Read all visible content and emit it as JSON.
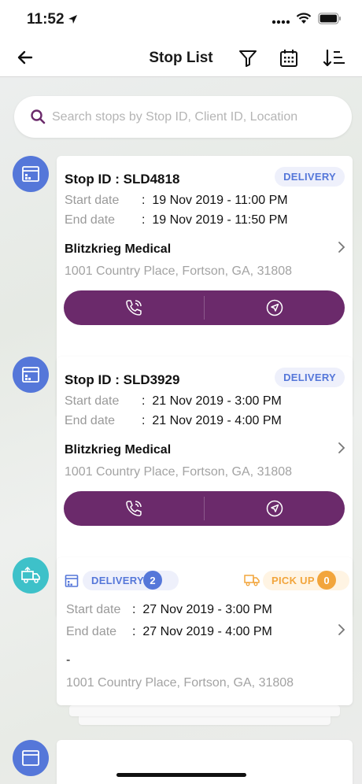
{
  "status_bar": {
    "time": "11:52"
  },
  "nav": {
    "title": "Stop List"
  },
  "search": {
    "placeholder": "Search stops by Stop ID, Client ID, Location"
  },
  "stops": [
    {
      "stop_id": "Stop ID : SLD4818",
      "type_badge": "DELIVERY",
      "start_label": "Start date",
      "start_value": "19 Nov 2019 - 11:00 PM",
      "end_label": "End date",
      "end_value": "19 Nov 2019 - 11:50 PM",
      "client": "Blitzkrieg Medical",
      "address": "1001 Country Place, Fortson, GA, 31808"
    },
    {
      "stop_id": "Stop ID : SLD3929",
      "type_badge": "DELIVERY",
      "start_label": "Start date",
      "start_value": "21 Nov 2019 - 3:00 PM",
      "end_label": "End date",
      "end_value": "21 Nov 2019 - 4:00 PM",
      "client": "Blitzkrieg Medical",
      "address": "1001 Country Place, Fortson, GA, 31808"
    }
  ],
  "grouped_stop": {
    "delivery_label": "DELIVERY",
    "delivery_count": "2",
    "pickup_label": "PICK UP",
    "pickup_count": "0",
    "start_label": "Start date",
    "start_value": "27 Nov 2019 - 3:00 PM",
    "end_label": "End date",
    "end_value": "27 Nov 2019 - 4:00 PM",
    "client": "-",
    "address": "1001 Country Place, Fortson, GA, 31808"
  },
  "colors": {
    "accent_purple": "#6b2a6b",
    "delivery_blue": "#5577d9",
    "pickup_orange": "#f2a53c",
    "teal": "#3ec1c9"
  },
  "icons": {
    "back": "arrow-left-icon",
    "filter": "filter-icon",
    "calendar": "calendar-icon",
    "sort": "sort-icon",
    "search": "search-icon",
    "call": "phone-call-icon",
    "navigate": "navigation-icon",
    "store": "store-icon",
    "truck": "truck-icon"
  }
}
